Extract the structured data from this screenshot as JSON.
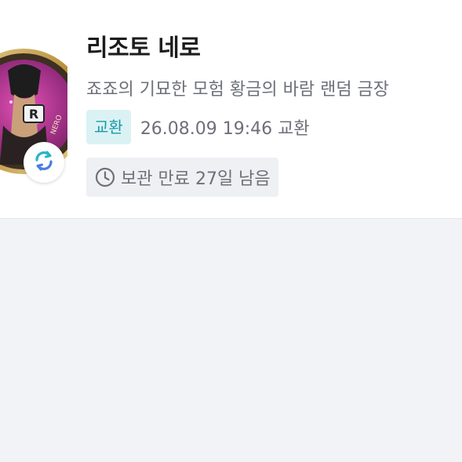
{
  "item": {
    "title": "리조토 네로",
    "description": "죠죠의 기묘한 모험 황금의 바람 랜덤 금장",
    "badge": "교환",
    "datetime_status": "26.08.09 19:46 교환",
    "expiry_text": "보관 만료 27일 남음"
  },
  "thumbnail": {
    "rim_text": "NERO",
    "badge_letter": "R"
  },
  "icons": {
    "swap": "swap-icon",
    "clock": "clock-icon"
  },
  "colors": {
    "badge_bg": "#dbf2f4",
    "badge_text": "#1a9aa8",
    "swap_teal": "#27b5c8",
    "swap_blue": "#4a7ee0"
  }
}
